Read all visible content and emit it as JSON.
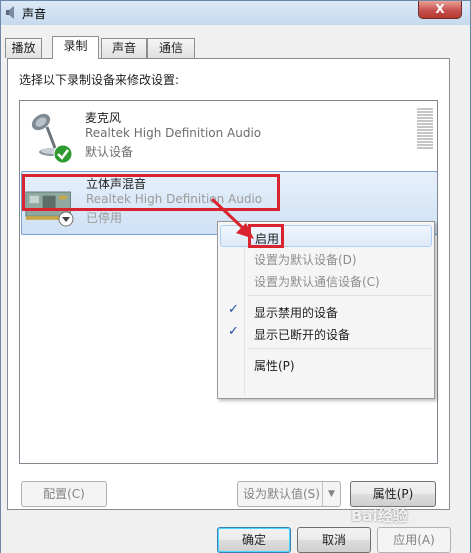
{
  "window": {
    "title": "声音",
    "close_glyph": "X"
  },
  "tabs": [
    {
      "label": "播放"
    },
    {
      "label": "录制"
    },
    {
      "label": "声音"
    },
    {
      "label": "通信"
    }
  ],
  "active_tab": "录制",
  "panel": {
    "caption": "选择以下录制设备来修改设置:"
  },
  "devices": [
    {
      "name": "麦克风",
      "driver": "Realtek High Definition Audio",
      "status": "默认设备",
      "icon": "microphone-icon",
      "badge": "default-check-badge"
    },
    {
      "name": "立体声混音",
      "driver": "Realtek High Definition Audio",
      "status": "已停用",
      "icon": "sound-card-icon",
      "badge": "disabled-down-arrow-badge"
    }
  ],
  "context_menu": {
    "items": [
      {
        "label": "启用",
        "state": "highlighted"
      },
      {
        "label": "设置为默认设备(D)",
        "state": "disabled"
      },
      {
        "label": "设置为默认通信设备(C)",
        "state": "disabled"
      },
      {
        "label": "显示禁用的设备",
        "checked": true
      },
      {
        "label": "显示已断开的设备",
        "checked": true
      },
      {
        "label": "属性(P)"
      }
    ],
    "check_glyph": "✓"
  },
  "buttons": {
    "configure": "配置(C)",
    "set_default": "设为默认值(S)",
    "set_default_arrow": "▼",
    "properties": "属性(P)",
    "ok": "确定",
    "cancel": "取消",
    "apply": "应用(A)"
  },
  "annotation_color": "#d9232e",
  "watermark": "Bai经验"
}
